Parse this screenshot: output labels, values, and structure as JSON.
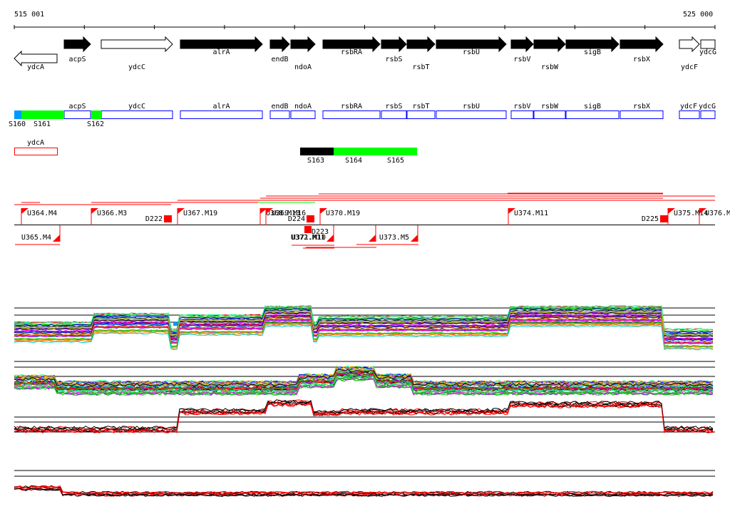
{
  "coords": {
    "start": "515 001",
    "end": "525 000"
  },
  "genes": [
    "ydcA",
    "acpS",
    "ydcC",
    "alrA",
    "endB",
    "ndoA",
    "rsbRA",
    "rsbS",
    "rsbT",
    "rsbU",
    "rsbV",
    "rsbW",
    "sigB",
    "rsbX",
    "ydcF",
    "ydcG"
  ],
  "segments": [
    "S160",
    "S161",
    "S162",
    "S163",
    "S164",
    "S165"
  ],
  "antisense_gene": "ydcA",
  "features": [
    "U364.M4",
    "U365.M4",
    "U366.M3",
    "D222",
    "U367.M19",
    "U368.M13",
    "U369.M16",
    "D224",
    "D223",
    "U370.M19",
    "U371.M10",
    "U372.M11",
    "U373.M5",
    "U374.M11",
    "D225",
    "U375.M14",
    "U376.M"
  ],
  "colors": {
    "blue_box": "#0000ff",
    "green_seg": "#00ff00",
    "blue_seg": "#0099ff",
    "feature_red": "#ff0000"
  }
}
